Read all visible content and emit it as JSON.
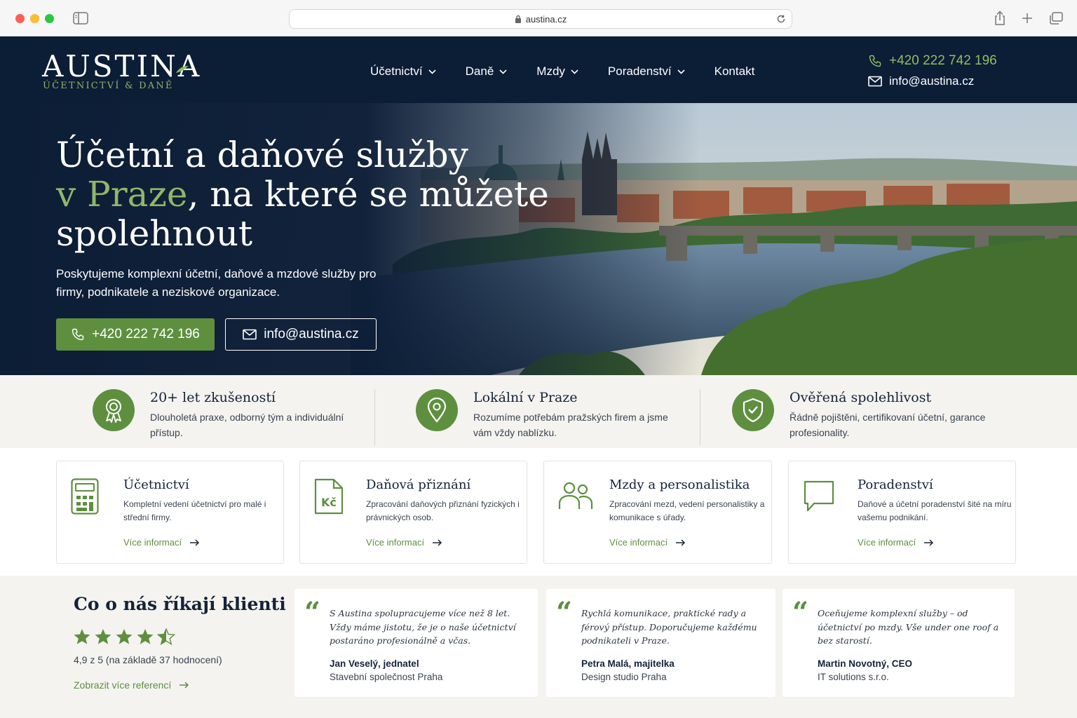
{
  "browser": {
    "url": "austina.cz"
  },
  "header": {
    "logo_main": "AUSTINA",
    "logo_sub": "ÚČETNICTVÍ & DANĚ",
    "nav": [
      {
        "label": "Účetnictví",
        "has_dropdown": true
      },
      {
        "label": "Daně",
        "has_dropdown": true
      },
      {
        "label": "Mzdy",
        "has_dropdown": true
      },
      {
        "label": "Poradenství",
        "has_dropdown": true
      },
      {
        "label": "Kontakt",
        "has_dropdown": false
      }
    ],
    "phone": "+420 222 742 196",
    "email": "info@austina.cz"
  },
  "hero": {
    "title_line1": "Účetní a daňové služby",
    "title_accent": "v Praze",
    "title_line2_rest": ", na které se můžete",
    "title_line3": "spolehnout",
    "description": "Poskytujeme komplexní účetní, daňové a mzdové služby pro firmy, podnikatele a neziskové organizace.",
    "phone_button": "+420 222 742 196",
    "email_button": "info@austina.cz"
  },
  "features": [
    {
      "icon": "award-icon",
      "title": "20+ let zkušeností",
      "desc": "Dlouholetá praxe, odborný tým a individuální přístup."
    },
    {
      "icon": "location-pin-icon",
      "title": "Lokální v Praze",
      "desc": "Rozumíme potřebám pražských firem a jsme vám vždy nablízku."
    },
    {
      "icon": "shield-check-icon",
      "title": "Ověřená spolehlivost",
      "desc": "Řádně pojištěni, certifikovaní účetní, garance profesionality."
    }
  ],
  "services": [
    {
      "icon": "calculator-icon",
      "title": "Účetnictví",
      "desc": "Kompletní vedení účetnictví pro malé i střední firmy.",
      "link": "Více informací"
    },
    {
      "icon": "tax-document-icon",
      "title": "Daňová přiznání",
      "desc": "Zpracování daňových přiznání fyzických i právnických osob.",
      "link": "Více informací",
      "icon_text": "Kč"
    },
    {
      "icon": "people-icon",
      "title": "Mzdy a personalistika",
      "desc": "Zpracování mezd, vedení personalistiky a komunikace s úřady.",
      "link": "Více informací"
    },
    {
      "icon": "speech-bubble-icon",
      "title": "Poradenství",
      "desc": "Daňové a účetní poradenství šité na míru vašemu podnikání.",
      "link": "Více informací"
    }
  ],
  "testimonials": {
    "heading": "Co o nás říkají klienti",
    "stars": 4.5,
    "rating_text": "4,9 z 5 (na základě 37 hodnocení)",
    "more_link": "Zobrazit více referencí",
    "quote_mark": "“",
    "items": [
      {
        "quote": "S Austina spolupracujeme více než 8 let. Vždy máme jistotu, že je o naše účetnictví postaráno profesionálně a včas.",
        "name": "Jan Veselý, jednatel",
        "company": "Stavební společnost Praha"
      },
      {
        "quote": "Rychlá komunikace, praktické rady a férový přístup. Doporučujeme každému podnikateli v Praze.",
        "name": "Petra Malá, majitelka",
        "company": "Design studio Praha"
      },
      {
        "quote": "Oceňujeme komplexní služby – od účetnictví po mzdy. Vše under one roof a bez starostí.",
        "name": "Martin Novotný, CEO",
        "company": "IT solutions s.r.o."
      }
    ]
  },
  "colors": {
    "navy": "#0c1d36",
    "green": "#5e8f3f",
    "green_light": "#8fb768",
    "background": "#f4f3ef"
  }
}
